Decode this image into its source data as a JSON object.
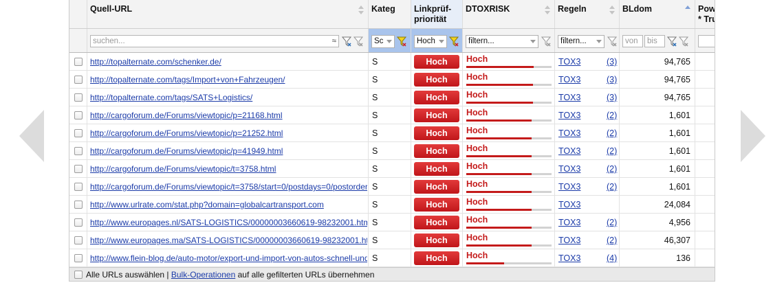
{
  "columns": {
    "url": "Quell-URL",
    "kategorie": "Kateg",
    "prio_line1": "Linkprüf-",
    "prio_line2": "priorität",
    "dtox": "DTOXRISK",
    "regeln": "Regeln",
    "bldom": "BLdom",
    "pow_line1": "Pow",
    "pow_line2": "* Tru"
  },
  "filters": {
    "url_placeholder": "suchen...",
    "kategorie_value": "Sc",
    "prio_value": "Hoch",
    "dtox_value": "filtern...",
    "regeln_value": "filtern...",
    "bldom_from": "von",
    "bldom_to": "bis"
  },
  "rows": [
    {
      "url": "http://topalternate.com/schenker.de/",
      "kategorie": "S",
      "prio": "Hoch",
      "dtox": "Hoch",
      "dtox_level": 0.79,
      "regel": "TOX3",
      "regel_count": "(3)",
      "bldom": "94,765"
    },
    {
      "url": "http://topalternate.com/tags/Import+von+Fahrzeugen/",
      "kategorie": "S",
      "prio": "Hoch",
      "dtox": "Hoch",
      "dtox_level": 0.78,
      "regel": "TOX3",
      "regel_count": "(3)",
      "bldom": "94,765"
    },
    {
      "url": "http://topalternate.com/tags/SATS+Logistics/",
      "kategorie": "S",
      "prio": "Hoch",
      "dtox": "Hoch",
      "dtox_level": 0.78,
      "regel": "TOX3",
      "regel_count": "(3)",
      "bldom": "94,765"
    },
    {
      "url": "http://cargoforum.de/Forums/viewtopic/p=21168.html",
      "kategorie": "S",
      "prio": "Hoch",
      "dtox": "Hoch",
      "dtox_level": 0.77,
      "regel": "TOX3",
      "regel_count": "(2)",
      "bldom": "1,601"
    },
    {
      "url": "http://cargoforum.de/Forums/viewtopic/p=21252.html",
      "kategorie": "S",
      "prio": "Hoch",
      "dtox": "Hoch",
      "dtox_level": 0.77,
      "regel": "TOX3",
      "regel_count": "(2)",
      "bldom": "1,601"
    },
    {
      "url": "http://cargoforum.de/Forums/viewtopic/p=41949.html",
      "kategorie": "S",
      "prio": "Hoch",
      "dtox": "Hoch",
      "dtox_level": 0.77,
      "regel": "TOX3",
      "regel_count": "(2)",
      "bldom": "1,601"
    },
    {
      "url": "http://cargoforum.de/Forums/viewtopic/t=3758.html",
      "kategorie": "S",
      "prio": "Hoch",
      "dtox": "Hoch",
      "dtox_level": 0.77,
      "regel": "TOX3",
      "regel_count": "(2)",
      "bldom": "1,601"
    },
    {
      "url": "http://cargoforum.de/Forums/viewtopic/t=3758/start=0/postdays=0/postorder",
      "kategorie": "S",
      "prio": "Hoch",
      "dtox": "Hoch",
      "dtox_level": 0.77,
      "regel": "TOX3",
      "regel_count": "(2)",
      "bldom": "1,601"
    },
    {
      "url": "http://www.urlrate.com/stat.php?domain=globalcartransport.com",
      "kategorie": "S",
      "prio": "Hoch",
      "dtox": "Hoch",
      "dtox_level": 0.77,
      "regel": "TOX3",
      "regel_count": "",
      "bldom": "24,084"
    },
    {
      "url": "http://www.europages.nl/SATS-LOGISTICS/00000003660619-98232001.htm",
      "kategorie": "S",
      "prio": "Hoch",
      "dtox": "Hoch",
      "dtox_level": 0.77,
      "regel": "TOX3",
      "regel_count": "(2)",
      "bldom": "4,956"
    },
    {
      "url": "http://www.europages.ma/SATS-LOGISTICS/00000003660619-98232001.ht",
      "kategorie": "S",
      "prio": "Hoch",
      "dtox": "Hoch",
      "dtox_level": 0.77,
      "regel": "TOX3",
      "regel_count": "(2)",
      "bldom": "46,307"
    },
    {
      "url": "http://www.flein-blog.de/auto-motor/export-und-import-von-autos-schnell-und",
      "kategorie": "S",
      "prio": "Hoch",
      "dtox": "Hoch",
      "dtox_level": 0.44,
      "regel": "TOX3",
      "regel_count": "(4)",
      "bldom": "136"
    }
  ],
  "footer": {
    "select_all": "Alle URLs auswählen |",
    "bulk_link": "Bulk-Operationen",
    "rest": "auf alle gefilterten URLs übernehmen"
  },
  "colors": {
    "accent_red": "#c41a1a",
    "link_blue": "#1a3aa8",
    "filter_highlight": "#a9c4ec"
  },
  "icons": [
    "chevron-left-icon",
    "chevron-right-icon",
    "filter-icon",
    "filter-clear-icon",
    "sort-icon"
  ]
}
